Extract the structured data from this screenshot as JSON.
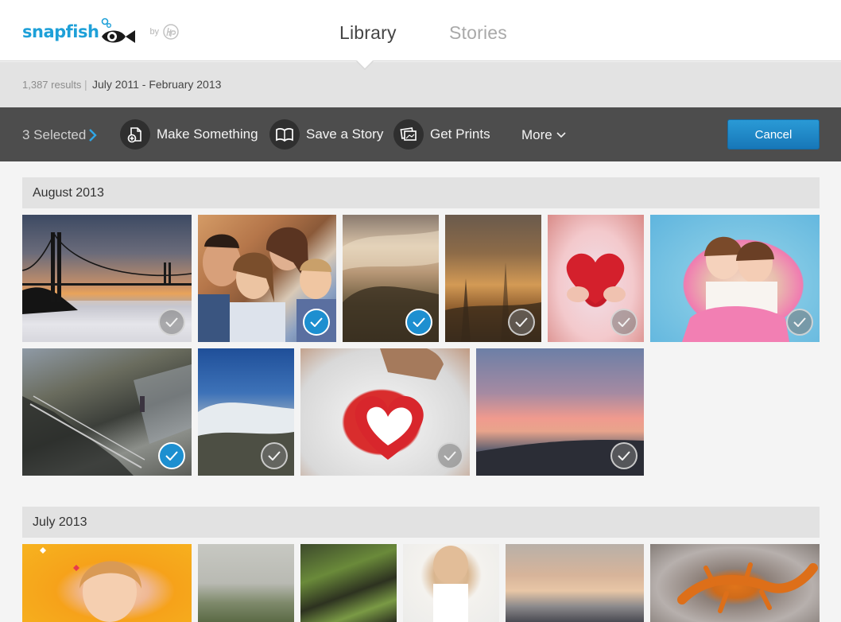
{
  "header": {
    "brand": "snapfish",
    "by_label": "by",
    "tabs": [
      {
        "label": "Library",
        "active": true
      },
      {
        "label": "Stories",
        "active": false
      }
    ]
  },
  "results": {
    "count": "1,387 results",
    "separator": "|",
    "date_range": "July 2011 - February 2013"
  },
  "action_bar": {
    "selected": "3 Selected",
    "actions": [
      {
        "label": "Make Something",
        "icon": "make-something-icon"
      },
      {
        "label": "Save a Story",
        "icon": "book-icon"
      },
      {
        "label": "Get Prints",
        "icon": "prints-icon"
      }
    ],
    "more_label": "More",
    "cancel_label": "Cancel"
  },
  "sections": [
    {
      "title": "August 2013",
      "photos": [
        {
          "subject": "golden-gate-bridge-sunset",
          "selected": false
        },
        {
          "subject": "family-portrait",
          "selected": true
        },
        {
          "subject": "misty-hills",
          "selected": true
        },
        {
          "subject": "foggy-sunlight",
          "selected": false
        },
        {
          "subject": "girl-holding-heart",
          "selected": false
        },
        {
          "subject": "two-girls-hugging",
          "selected": false
        },
        {
          "subject": "stairway-on-cliff",
          "selected": true
        },
        {
          "subject": "snowy-mountain",
          "selected": false
        },
        {
          "subject": "valentine-on-back",
          "selected": false
        },
        {
          "subject": "pink-sunset-sky",
          "selected": false
        }
      ]
    },
    {
      "title": "July 2013",
      "photos": [
        {
          "subject": "girl-yellow-background"
        },
        {
          "subject": "foggy-hillside"
        },
        {
          "subject": "mossy-rocks"
        },
        {
          "subject": "girl-white-dress"
        },
        {
          "subject": "clouds-over-sea"
        },
        {
          "subject": "orange-newt"
        }
      ]
    }
  ],
  "colors": {
    "brand_blue": "#1ea0d8",
    "cancel_blue": "#1d85c6",
    "selected_check": "#1d8fd0",
    "action_bar_bg": "#4d4d4d"
  }
}
